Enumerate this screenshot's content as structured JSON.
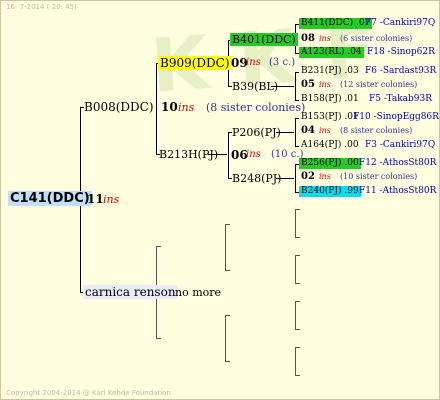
{
  "header": "16- 7-2014 ( 20: 45)",
  "footer": "Copyright 2004-2014 @ Karl Kehde Foundation",
  "colors": {
    "background": "#ffffe0",
    "root_box": "#c0e0ff",
    "yellow": "#ffff00",
    "green": "#22cc22",
    "cyan": "#00e0f0",
    "ins": "#e00000",
    "location": "#0000cc",
    "sister": "#3030a0"
  },
  "root": {
    "name": "C141(DDC)",
    "year": "11",
    "mark": "ins"
  },
  "gen1": [
    {
      "name": "B008(DDC)"
    },
    {
      "name": "carnica renson",
      "note": "no more"
    }
  ],
  "gen1_info": {
    "year": "10",
    "mark": "ins",
    "sisters": "(8 sister colonies)"
  },
  "gen2": [
    {
      "name": "B909(DDC)"
    },
    {
      "name": "B213H(PJ)"
    }
  ],
  "gen2_info": [
    {
      "year": "09",
      "mark": "ins",
      "sisters": "(3 c.)"
    },
    {
      "year": "06",
      "mark": "ins",
      "sisters": "(10 c.)"
    }
  ],
  "gen3": [
    {
      "name": "B401(DDC)"
    },
    {
      "name": "B39(BL)"
    },
    {
      "name": "P206(PJ)"
    },
    {
      "name": "B248(PJ)"
    }
  ],
  "gen4": [
    {
      "name": "B411(DDC)",
      "val": ".07",
      "loc": "F7 -Cankiri97Q"
    },
    {
      "info": "08",
      "mark": "ins",
      "sisters": "(6 sister colonies)"
    },
    {
      "name": "A123(RL)",
      "val": ".04",
      "loc": "F18 -Sinop62R"
    },
    {
      "name": "B231(PJ)",
      "val": ".03",
      "loc": "F6 -Sardast93R"
    },
    {
      "info": "05",
      "mark": "ins",
      "sisters": "(12 sister colonies)"
    },
    {
      "name": "B158(PJ)",
      "val": ".01",
      "loc": "F5 -Takab93R"
    },
    {
      "name": "B153(PJ)",
      "val": ".01",
      "loc": "F10 -SinopEgg86R"
    },
    {
      "info": "04",
      "mark": "ins",
      "sisters": "(8 sister colonies)"
    },
    {
      "name": "A164(PJ)",
      "val": ".00",
      "loc": "F3 -Cankiri97Q"
    },
    {
      "name": "B256(PJ)",
      "val": ".00",
      "loc": "F12 -AthosSt80R"
    },
    {
      "info": "02",
      "mark": "ins",
      "sisters": "(10 sister colonies)"
    },
    {
      "name": "B240(PJ)",
      "val": ".99",
      "loc": "F11 -AthosSt80R"
    }
  ]
}
